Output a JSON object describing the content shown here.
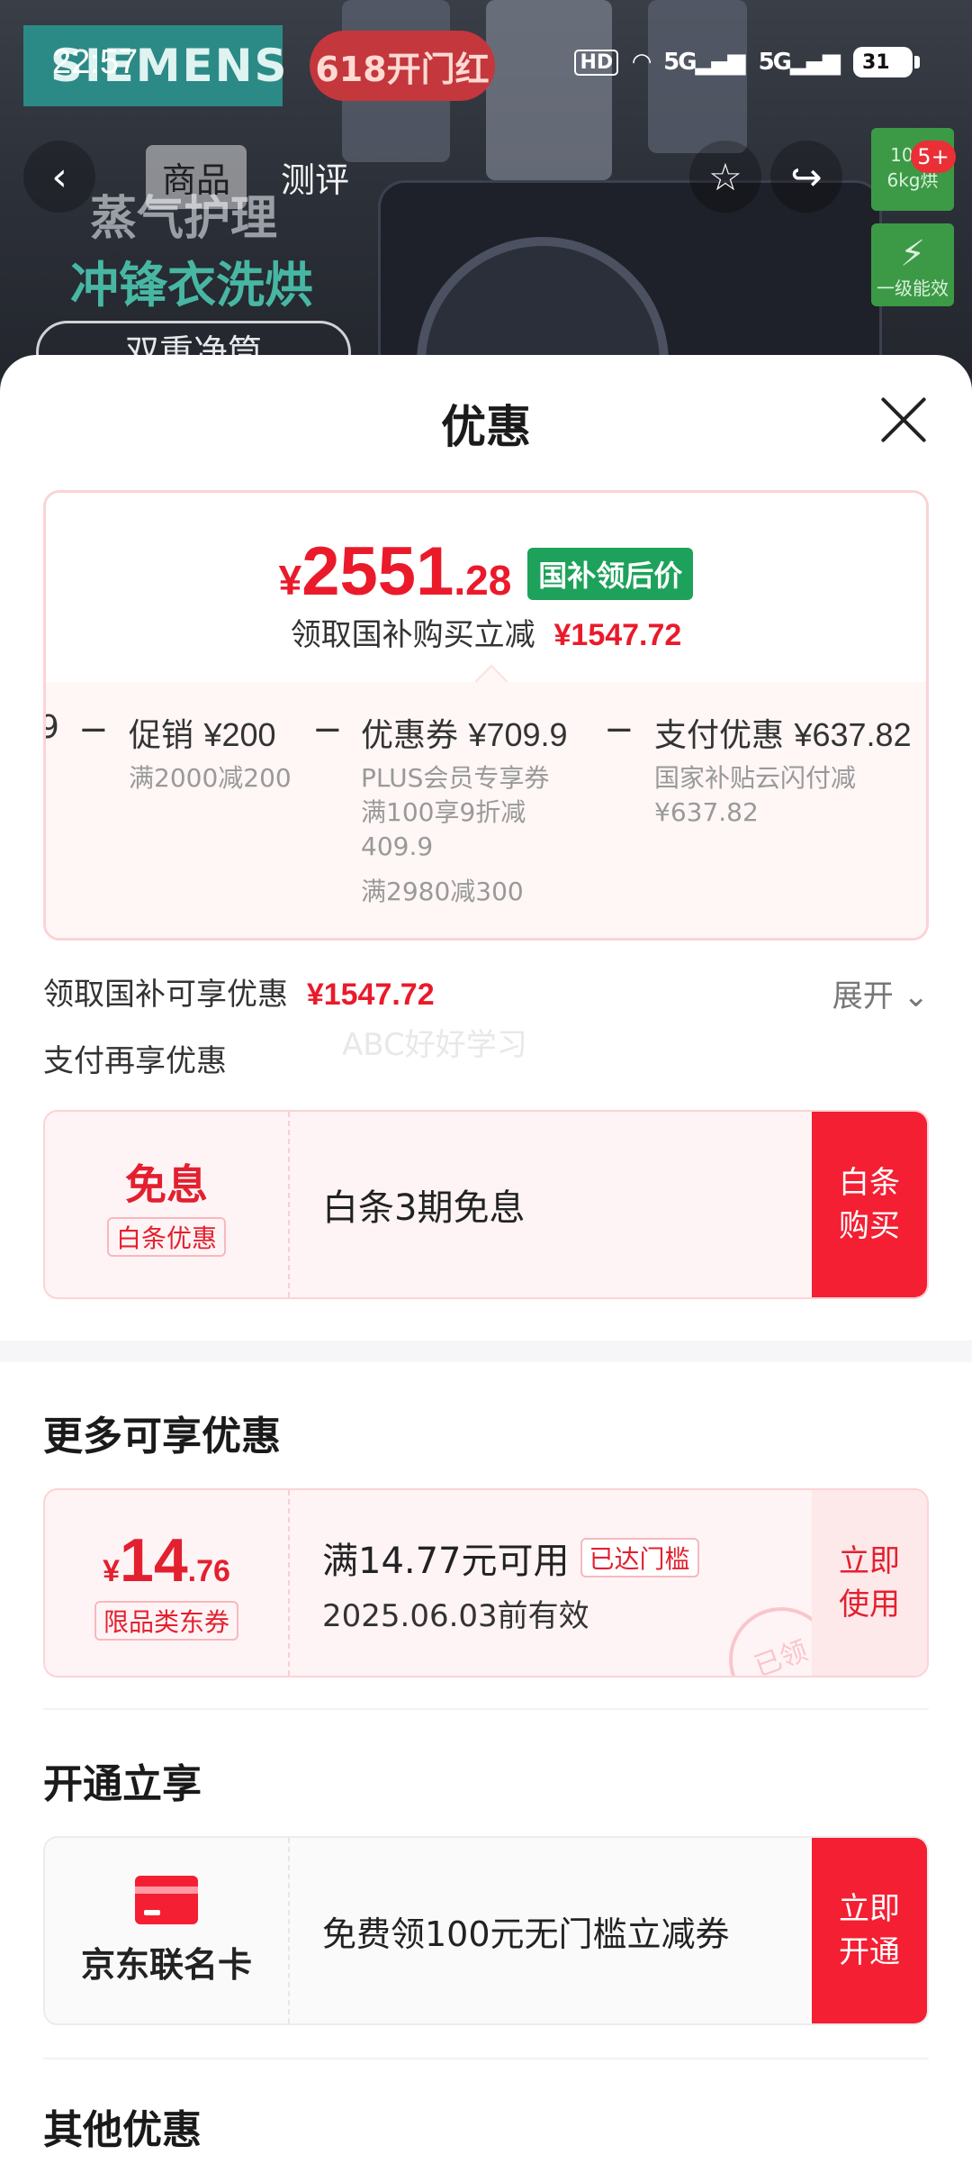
{
  "status_bar": {
    "time": "22:57",
    "hd": "HD",
    "net1": "5G",
    "net2": "5G",
    "battery": "31"
  },
  "hero": {
    "brand": "SIEMENS",
    "promo": "618开门红",
    "slogan_1": "蒸气护理",
    "slogan_2": "冲锋衣洗烘",
    "slogan_3": "双重净筒",
    "badge_capacity": "10kg 6kg烘",
    "badge_energy": "一级能效"
  },
  "nav": {
    "tabs": [
      "商品",
      "测评"
    ],
    "cart_badge": "5+"
  },
  "sheet": {
    "title": "优惠",
    "price": {
      "yen": "¥",
      "integer": "2551",
      "decimal": ".28",
      "tag": "国补领后价"
    },
    "subsidy_line": {
      "label": "领取国补购买立减",
      "amount": "¥1547.72"
    },
    "breakdown": [
      {
        "head_label": "促销",
        "head_value": "¥200",
        "desc": [
          "满2000减200"
        ]
      },
      {
        "head_label": "优惠券",
        "head_value": "¥709.9",
        "desc": [
          "PLUS会员专享券",
          "满100享9折减",
          "409.9",
          "满2980减300"
        ]
      },
      {
        "head_label": "支付优惠",
        "head_value": "¥637.82",
        "desc": [
          "国家补贴云闪付减",
          "¥637.82"
        ]
      }
    ],
    "partial_left": "9",
    "minus": "−",
    "enjoy_line": {
      "label": "领取国补可享优惠",
      "amount": "¥1547.72"
    },
    "expand": "展开 ⌄",
    "pay_more": "支付再享优惠",
    "watermark": "ABC好好学习",
    "baitiao": {
      "title": "免息",
      "tag": "白条优惠",
      "desc": "白条3期免息",
      "action": "白条\n购买"
    },
    "more_title": "更多可享优惠",
    "coupon": {
      "yen": "¥",
      "integer": "14",
      "decimal": ".76",
      "tag": "限品类东券",
      "cond": "满14.77元可用",
      "badge": "已达门槛",
      "valid": "2025.06.03前有效",
      "stamp": "已领",
      "action": "立即\n使用"
    },
    "open_title": "开通立享",
    "card": {
      "name": "京东联名卡",
      "desc": "免费领100元无门槛立减券",
      "action": "立即\n开通"
    },
    "other_title": "其他优惠"
  },
  "colors": {
    "accent_red": "#f41f33",
    "subsidy_green": "#1ea25b"
  }
}
